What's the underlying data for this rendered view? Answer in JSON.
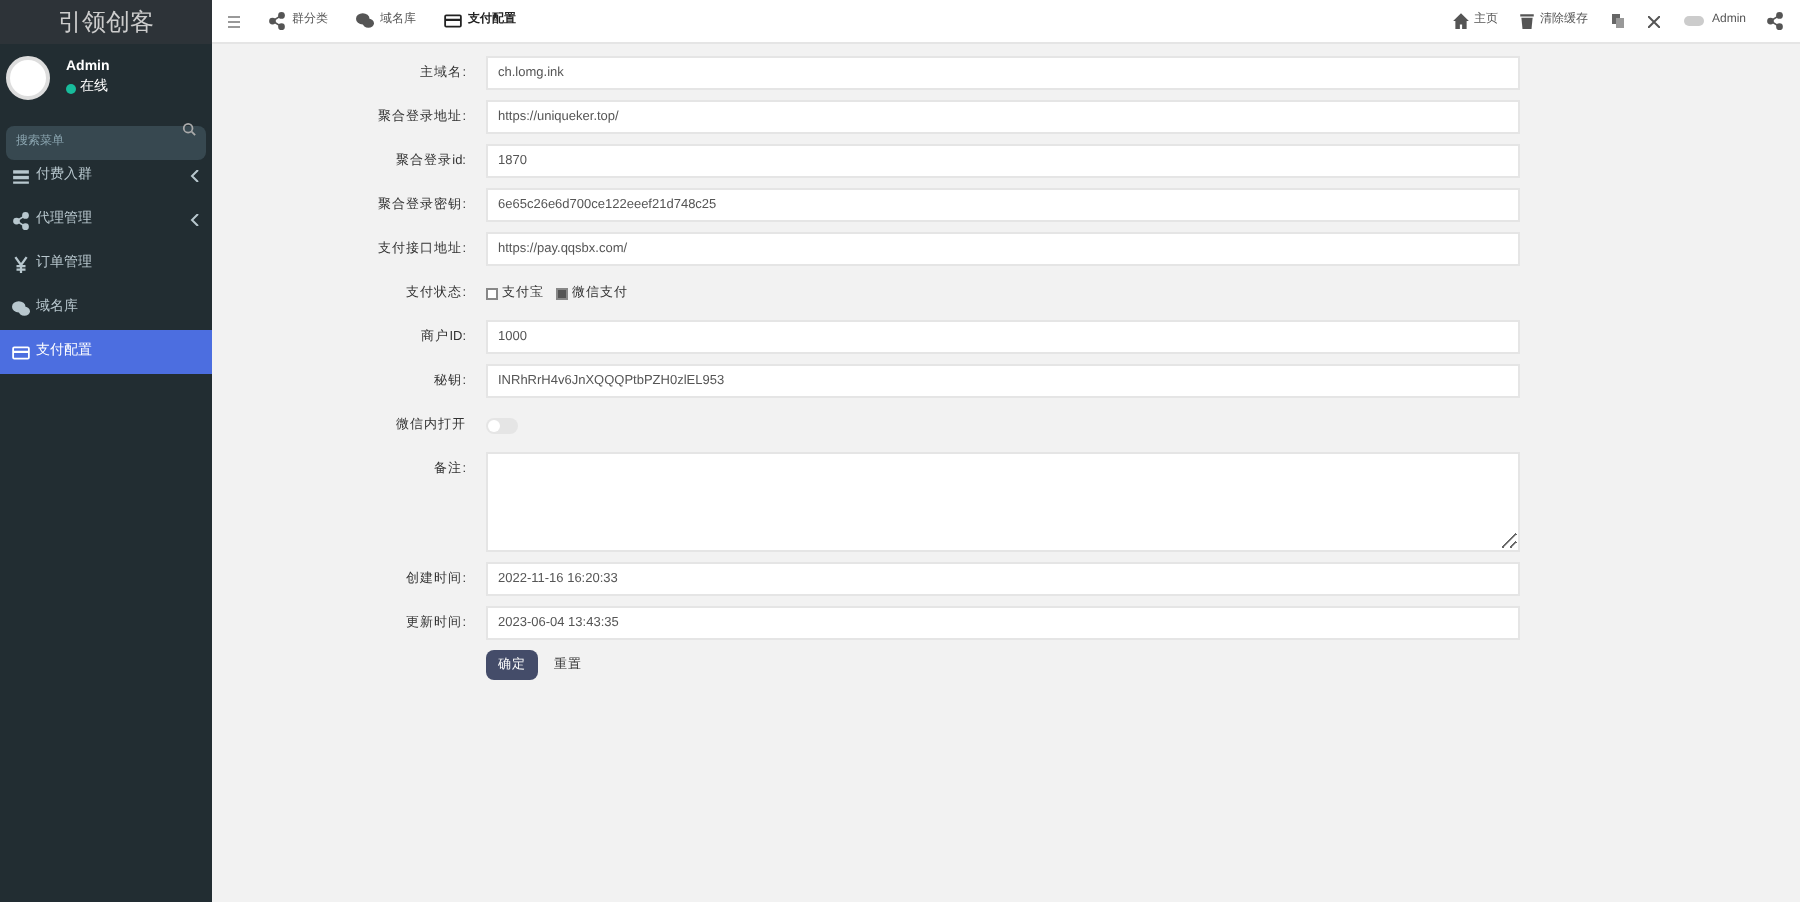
{
  "sidebar": {
    "brand": "引领创客",
    "user": {
      "name": "Admin",
      "status": "在线"
    },
    "search": {
      "placeholder": "搜索菜单"
    },
    "items": [
      {
        "label": "付费入群",
        "kind": "list",
        "expandable": true,
        "selected": false
      },
      {
        "label": "代理管理",
        "kind": "share",
        "expandable": true,
        "selected": false
      },
      {
        "label": "订单管理",
        "kind": "yen",
        "expandable": false,
        "selected": false
      },
      {
        "label": "域名库",
        "kind": "chat",
        "expandable": false,
        "selected": false
      },
      {
        "label": "支付配置",
        "kind": "card",
        "expandable": false,
        "selected": true
      }
    ]
  },
  "topbar": {
    "tabs": [
      {
        "label": "群分类",
        "kind": "share",
        "selected": false
      },
      {
        "label": "域名库",
        "kind": "chat",
        "selected": false
      },
      {
        "label": "支付配置",
        "kind": "card",
        "selected": true
      }
    ],
    "right": [
      {
        "label": "主页",
        "kind": "home"
      },
      {
        "label": "清除缓存",
        "kind": "trash"
      }
    ],
    "user": "Admin"
  },
  "form": {
    "rows": [
      {
        "kind": "text",
        "label": "主域名:",
        "value": "ch.lomg.ink"
      },
      {
        "kind": "text",
        "label": "聚合登录地址:",
        "value": "https://uniqueker.top/"
      },
      {
        "kind": "text",
        "label": "聚合登录id:",
        "value": "1870"
      },
      {
        "kind": "text",
        "label": "聚合登录密钥:",
        "value": "6e65c26e6d700ce122eeef21d748c25"
      },
      {
        "kind": "text",
        "label": "支付接口地址:",
        "value": "https://pay.qqsbx.com/"
      },
      {
        "kind": "checks",
        "label": "支付状态:",
        "options": [
          {
            "label": "支付宝",
            "checked": false
          },
          {
            "label": "微信支付",
            "checked": true
          }
        ]
      },
      {
        "kind": "text",
        "label": "商户ID:",
        "value": "1000"
      },
      {
        "kind": "text",
        "label": "秘钥:",
        "value": "INRhRrH4v6JnXQQQPtbPZH0zlEL953"
      },
      {
        "kind": "toggle",
        "label": "微信内打开",
        "on": false
      },
      {
        "kind": "textarea",
        "label": "备注:"
      },
      {
        "kind": "text",
        "label": "创建时间:",
        "value": "2022-11-16 16:20:33"
      },
      {
        "kind": "text",
        "label": "更新时间:",
        "value": "2023-06-04 13:43:35"
      }
    ],
    "buttons": [
      {
        "label": "确定",
        "primary": true
      },
      {
        "label": "重置",
        "primary": false
      }
    ]
  }
}
